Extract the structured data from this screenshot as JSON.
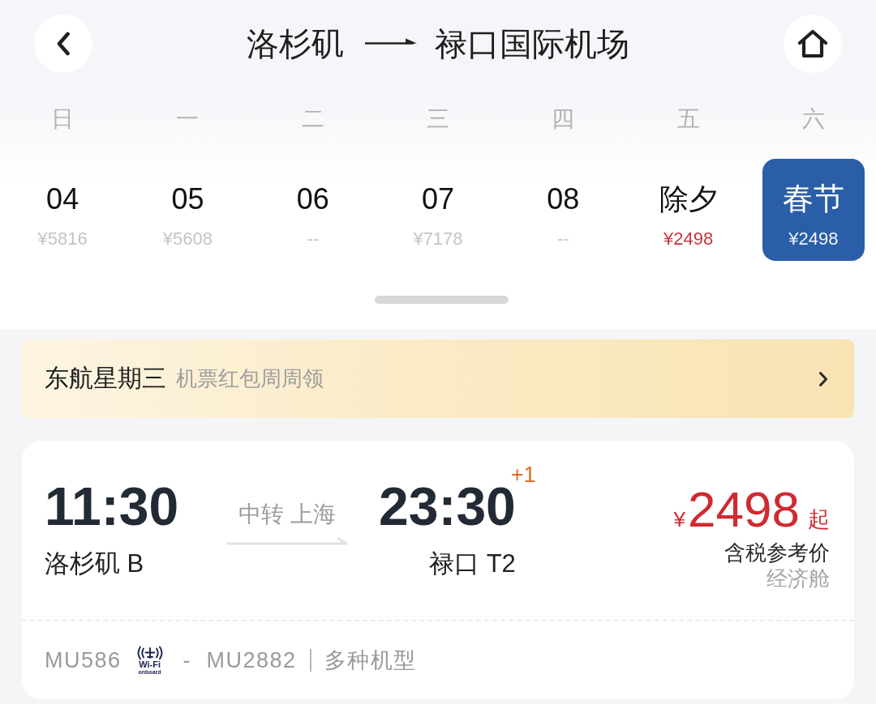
{
  "header": {
    "origin": "洛杉矶",
    "destination": "禄口国际机场"
  },
  "calendar": {
    "weekdays": [
      "日",
      "一",
      "二",
      "三",
      "四",
      "五",
      "六"
    ],
    "days": [
      {
        "date": "04",
        "price": "¥5816",
        "lowest": false,
        "selected": false
      },
      {
        "date": "05",
        "price": "¥5608",
        "lowest": false,
        "selected": false
      },
      {
        "date": "06",
        "price": "--",
        "lowest": false,
        "selected": false
      },
      {
        "date": "07",
        "price": "¥7178",
        "lowest": false,
        "selected": false
      },
      {
        "date": "08",
        "price": "--",
        "lowest": false,
        "selected": false
      },
      {
        "date": "除夕",
        "price": "¥2498",
        "lowest": true,
        "selected": false
      },
      {
        "date": "春节",
        "price": "¥2498",
        "lowest": false,
        "selected": true
      }
    ]
  },
  "promo_banner": {
    "title": "东航星期三",
    "subtitle": "机票红包周周领"
  },
  "flight": {
    "departure": {
      "time": "11:30",
      "airport": "洛杉矶 B"
    },
    "transfer": "中转 上海",
    "arrival": {
      "time": "23:30",
      "day_offset": "+1",
      "airport": "禄口 T2"
    },
    "price": {
      "currency": "¥",
      "amount": "2498",
      "suffix": "起",
      "note": "含税参考价",
      "cabin": "经济舱"
    },
    "segments": [
      {
        "flight_no": "MU586",
        "wifi": true
      },
      {
        "flight_no": "MU2882",
        "wifi": false
      }
    ],
    "segment_separator": "-",
    "wifi_logo": {
      "label": "Wi-Fi",
      "caption": "onboard"
    },
    "aircraft": "多种机型"
  }
}
